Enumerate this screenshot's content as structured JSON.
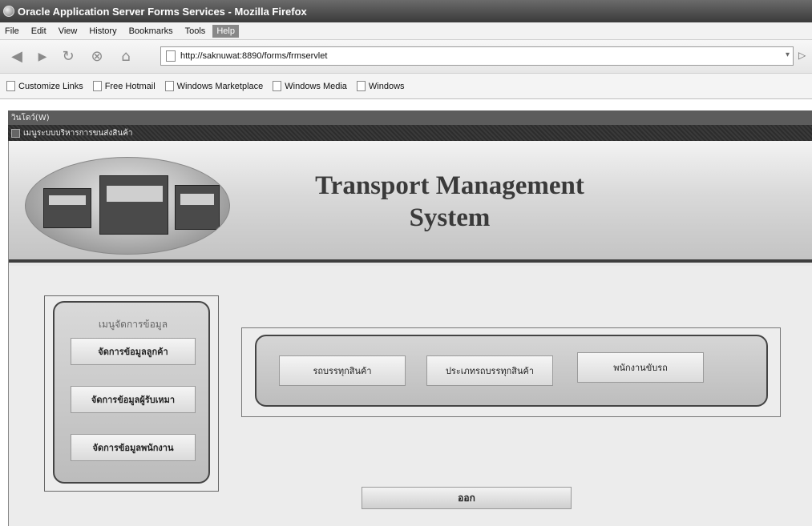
{
  "browser": {
    "window_title": "Oracle Application Server Forms Services - Mozilla Firefox",
    "menu": [
      "File",
      "Edit",
      "View",
      "History",
      "Bookmarks",
      "Tools",
      "Help"
    ],
    "url": "http://saknuwat:8890/forms/frmservlet",
    "bookmarks": [
      "Customize Links",
      "Free Hotmail",
      "Windows Marketplace",
      "Windows Media",
      "Windows"
    ]
  },
  "forms": {
    "window_menu": "วินโดว์(W)",
    "inner_title": "เมนูระบบบริหารการขนส่งสินค้า",
    "app_title_line1": "Transport Management",
    "app_title_line2": "System",
    "data_menu": {
      "title": "เมนูจัดการข้อมูล",
      "buttons": [
        "จัดการข้อมูลลูกค้า",
        "จัดการข้อมูลผู้รับเหมา",
        "จัดการข้อมูลพนักงาน"
      ]
    },
    "options": [
      "รถบรรทุกสินค้า",
      "ประเภทรถบรรทุกสินค้า",
      "พนักงานขับรถ"
    ],
    "exit_label": "ออก"
  }
}
